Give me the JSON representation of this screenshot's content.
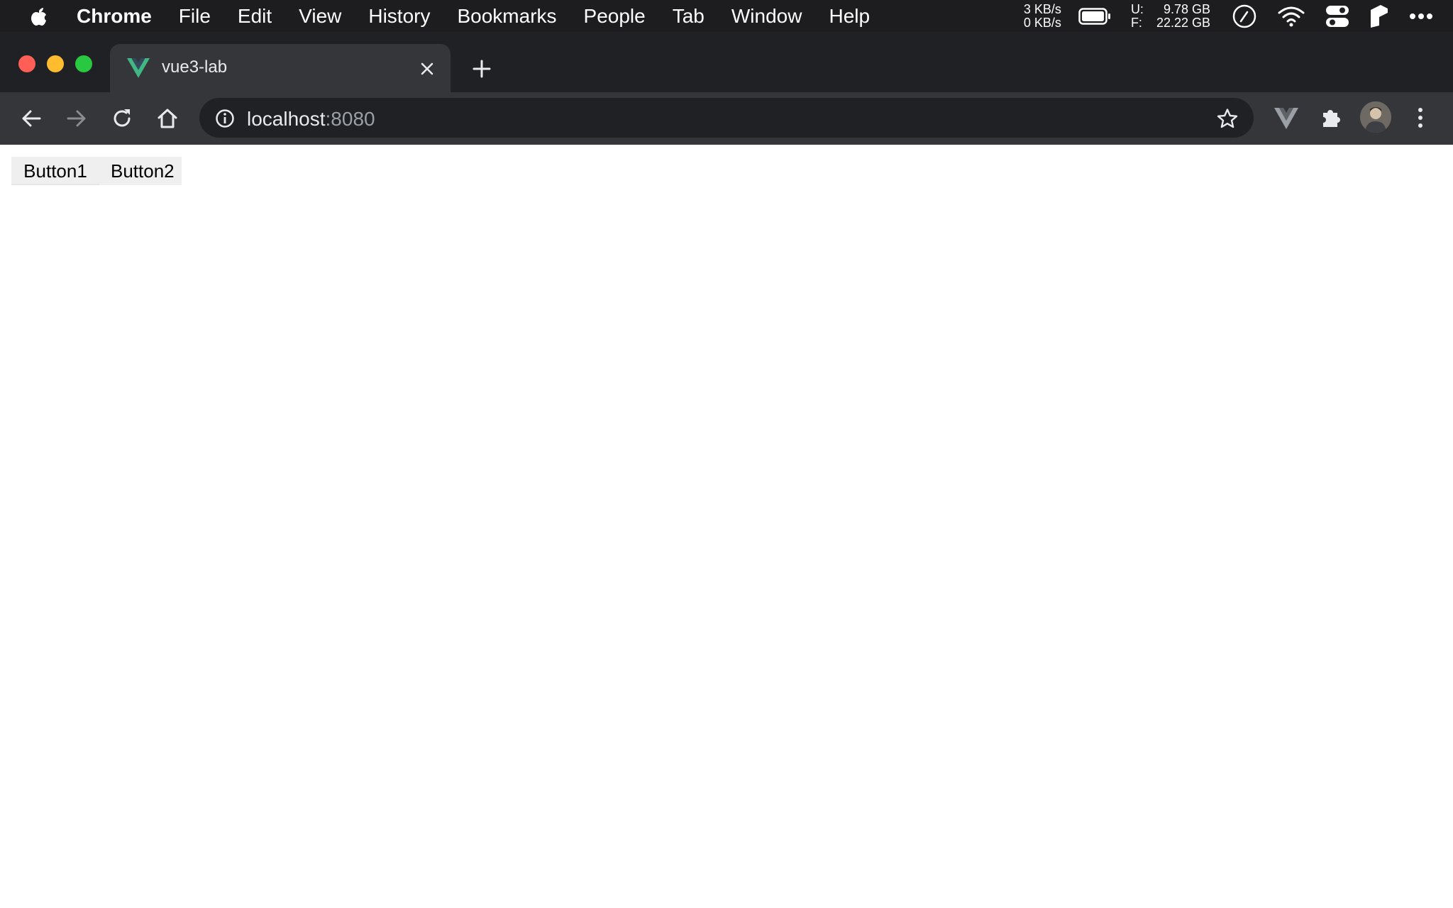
{
  "menubar": {
    "app_name": "Chrome",
    "items": [
      "File",
      "Edit",
      "View",
      "History",
      "Bookmarks",
      "People",
      "Tab",
      "Window",
      "Help"
    ],
    "net_up": "3 KB/s",
    "net_down": "0 KB/s",
    "disk_labels": [
      "U:",
      "F:"
    ],
    "disk_values": [
      "9.78 GB",
      "22.22 GB"
    ]
  },
  "browser": {
    "tab_title": "vue3-lab",
    "url_host": "localhost",
    "url_port": ":8080",
    "colors": {
      "vue_green": "#41b883",
      "vue_dark": "#35495e"
    }
  },
  "page": {
    "button1_label": "Button1",
    "button2_label": "Button2"
  }
}
